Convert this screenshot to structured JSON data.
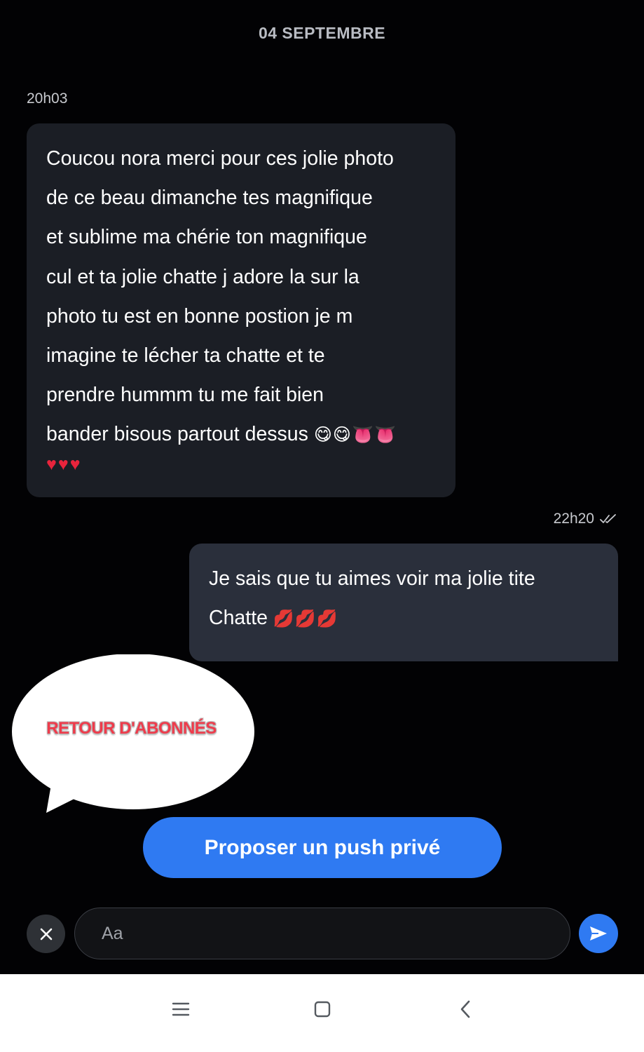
{
  "date_header": "04 SEPTEMBRE",
  "messages": {
    "incoming": {
      "time": "20h03",
      "lines": [
        "Coucou nora merci pour ces jolie photo",
        "de ce beau dimanche tes magnifique",
        "et sublime ma chérie ton magnifique",
        "cul et ta jolie chatte j adore la sur la",
        "photo tu est en bonne postion je m",
        "imagine te lécher ta chatte et te",
        "prendre hummm tu me fait bien",
        "bander bisous partout dessus"
      ],
      "emojis_line1": "😋😋👅👅",
      "emojis_line2": "♥♥♥"
    },
    "outgoing": {
      "time": "22h20",
      "status_icon": "double-check-icon",
      "lines": [
        "Je sais que tu aimes voir ma jolie tite",
        "Chatte"
      ],
      "emojis": "💋💋💋"
    }
  },
  "overlay": {
    "speech_bubble_text": "RETOUR D'ABONNÉS"
  },
  "actions": {
    "push_button_label": "Proposer un push privé"
  },
  "composer": {
    "placeholder": "Aa",
    "close_icon": "close-icon",
    "send_icon": "send-icon"
  },
  "navbar": {
    "icons": [
      "menu-icon",
      "home-square-icon",
      "back-chevron-icon"
    ]
  },
  "colors": {
    "background": "#020204",
    "incoming_bubble": "#1b1e25",
    "outgoing_bubble": "#2a2f3b",
    "accent_blue": "#2f7af2",
    "badge_red": "#ee3b4b"
  }
}
